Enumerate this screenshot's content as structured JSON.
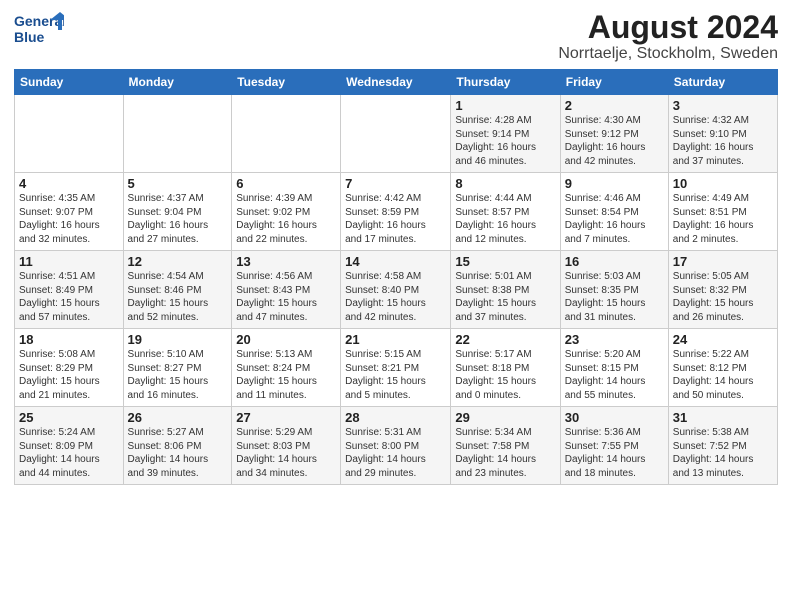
{
  "header": {
    "logo_line1": "General",
    "logo_line2": "Blue",
    "main_title": "August 2024",
    "subtitle": "Norrtaelje, Stockholm, Sweden"
  },
  "calendar": {
    "days_of_week": [
      "Sunday",
      "Monday",
      "Tuesday",
      "Wednesday",
      "Thursday",
      "Friday",
      "Saturday"
    ],
    "weeks": [
      [
        {
          "day": "",
          "info": ""
        },
        {
          "day": "",
          "info": ""
        },
        {
          "day": "",
          "info": ""
        },
        {
          "day": "",
          "info": ""
        },
        {
          "day": "1",
          "info": "Sunrise: 4:28 AM\nSunset: 9:14 PM\nDaylight: 16 hours\nand 46 minutes."
        },
        {
          "day": "2",
          "info": "Sunrise: 4:30 AM\nSunset: 9:12 PM\nDaylight: 16 hours\nand 42 minutes."
        },
        {
          "day": "3",
          "info": "Sunrise: 4:32 AM\nSunset: 9:10 PM\nDaylight: 16 hours\nand 37 minutes."
        }
      ],
      [
        {
          "day": "4",
          "info": "Sunrise: 4:35 AM\nSunset: 9:07 PM\nDaylight: 16 hours\nand 32 minutes."
        },
        {
          "day": "5",
          "info": "Sunrise: 4:37 AM\nSunset: 9:04 PM\nDaylight: 16 hours\nand 27 minutes."
        },
        {
          "day": "6",
          "info": "Sunrise: 4:39 AM\nSunset: 9:02 PM\nDaylight: 16 hours\nand 22 minutes."
        },
        {
          "day": "7",
          "info": "Sunrise: 4:42 AM\nSunset: 8:59 PM\nDaylight: 16 hours\nand 17 minutes."
        },
        {
          "day": "8",
          "info": "Sunrise: 4:44 AM\nSunset: 8:57 PM\nDaylight: 16 hours\nand 12 minutes."
        },
        {
          "day": "9",
          "info": "Sunrise: 4:46 AM\nSunset: 8:54 PM\nDaylight: 16 hours\nand 7 minutes."
        },
        {
          "day": "10",
          "info": "Sunrise: 4:49 AM\nSunset: 8:51 PM\nDaylight: 16 hours\nand 2 minutes."
        }
      ],
      [
        {
          "day": "11",
          "info": "Sunrise: 4:51 AM\nSunset: 8:49 PM\nDaylight: 15 hours\nand 57 minutes."
        },
        {
          "day": "12",
          "info": "Sunrise: 4:54 AM\nSunset: 8:46 PM\nDaylight: 15 hours\nand 52 minutes."
        },
        {
          "day": "13",
          "info": "Sunrise: 4:56 AM\nSunset: 8:43 PM\nDaylight: 15 hours\nand 47 minutes."
        },
        {
          "day": "14",
          "info": "Sunrise: 4:58 AM\nSunset: 8:40 PM\nDaylight: 15 hours\nand 42 minutes."
        },
        {
          "day": "15",
          "info": "Sunrise: 5:01 AM\nSunset: 8:38 PM\nDaylight: 15 hours\nand 37 minutes."
        },
        {
          "day": "16",
          "info": "Sunrise: 5:03 AM\nSunset: 8:35 PM\nDaylight: 15 hours\nand 31 minutes."
        },
        {
          "day": "17",
          "info": "Sunrise: 5:05 AM\nSunset: 8:32 PM\nDaylight: 15 hours\nand 26 minutes."
        }
      ],
      [
        {
          "day": "18",
          "info": "Sunrise: 5:08 AM\nSunset: 8:29 PM\nDaylight: 15 hours\nand 21 minutes."
        },
        {
          "day": "19",
          "info": "Sunrise: 5:10 AM\nSunset: 8:27 PM\nDaylight: 15 hours\nand 16 minutes."
        },
        {
          "day": "20",
          "info": "Sunrise: 5:13 AM\nSunset: 8:24 PM\nDaylight: 15 hours\nand 11 minutes."
        },
        {
          "day": "21",
          "info": "Sunrise: 5:15 AM\nSunset: 8:21 PM\nDaylight: 15 hours\nand 5 minutes."
        },
        {
          "day": "22",
          "info": "Sunrise: 5:17 AM\nSunset: 8:18 PM\nDaylight: 15 hours\nand 0 minutes."
        },
        {
          "day": "23",
          "info": "Sunrise: 5:20 AM\nSunset: 8:15 PM\nDaylight: 14 hours\nand 55 minutes."
        },
        {
          "day": "24",
          "info": "Sunrise: 5:22 AM\nSunset: 8:12 PM\nDaylight: 14 hours\nand 50 minutes."
        }
      ],
      [
        {
          "day": "25",
          "info": "Sunrise: 5:24 AM\nSunset: 8:09 PM\nDaylight: 14 hours\nand 44 minutes."
        },
        {
          "day": "26",
          "info": "Sunrise: 5:27 AM\nSunset: 8:06 PM\nDaylight: 14 hours\nand 39 minutes."
        },
        {
          "day": "27",
          "info": "Sunrise: 5:29 AM\nSunset: 8:03 PM\nDaylight: 14 hours\nand 34 minutes."
        },
        {
          "day": "28",
          "info": "Sunrise: 5:31 AM\nSunset: 8:00 PM\nDaylight: 14 hours\nand 29 minutes."
        },
        {
          "day": "29",
          "info": "Sunrise: 5:34 AM\nSunset: 7:58 PM\nDaylight: 14 hours\nand 23 minutes."
        },
        {
          "day": "30",
          "info": "Sunrise: 5:36 AM\nSunset: 7:55 PM\nDaylight: 14 hours\nand 18 minutes."
        },
        {
          "day": "31",
          "info": "Sunrise: 5:38 AM\nSunset: 7:52 PM\nDaylight: 14 hours\nand 13 minutes."
        }
      ]
    ]
  }
}
